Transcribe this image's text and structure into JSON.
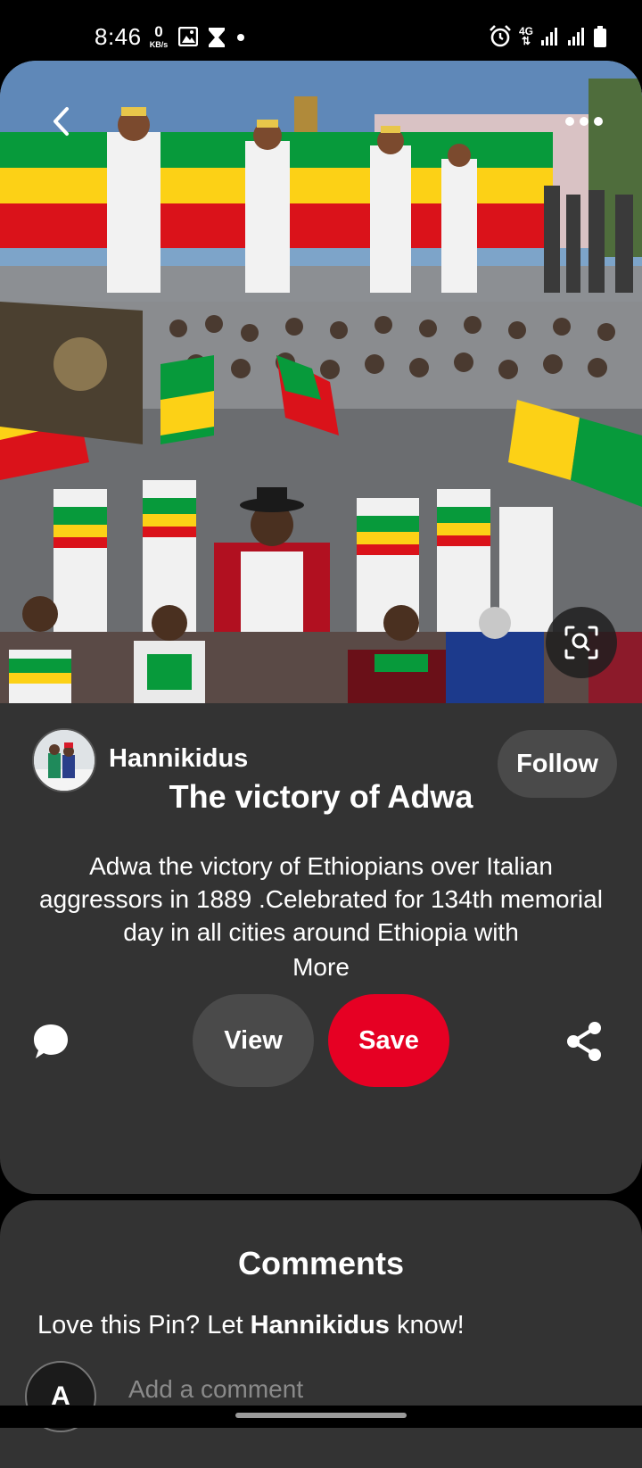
{
  "status_bar": {
    "time": "8:46",
    "speed_value": "0",
    "speed_unit": "KB/s",
    "network": "4G"
  },
  "pin": {
    "image_alt": "Ethiopian flags and crowds celebrating the victory of Adwa",
    "creator": {
      "name": "Hannikidus"
    },
    "follow_label": "Follow",
    "title": "The victory of Adwa",
    "description": "Adwa the victory of Ethiopians over Italian aggressors in 1889 .Celebrated for 134th memorial day in all cities around Ethiopia with",
    "more_label": "More",
    "view_label": "View",
    "save_label": "Save"
  },
  "comments": {
    "title": "Comments",
    "prompt_prefix": "Love this Pin? Let ",
    "prompt_name": "Hannikidus",
    "prompt_suffix": " know!",
    "user_initial": "A",
    "input_placeholder": "Add a comment"
  },
  "colors": {
    "card_bg": "#333333",
    "save_red": "#e60023",
    "button_gray": "#4a4a4a",
    "flag_green": "#079a3b",
    "flag_yellow": "#fcd116",
    "flag_red": "#da121a"
  }
}
